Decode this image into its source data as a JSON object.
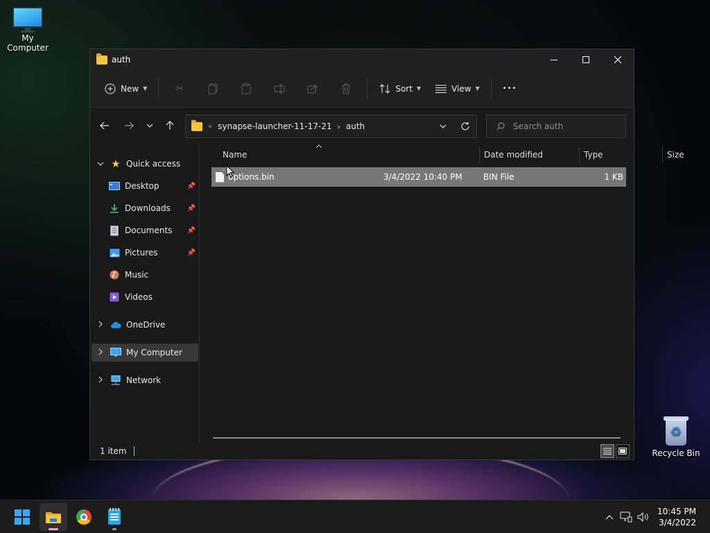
{
  "desktop": {
    "icons": [
      {
        "label": "My Computer",
        "icon": "monitor-icon"
      },
      {
        "label": "Recycle Bin",
        "icon": "recycle-bin-icon"
      }
    ]
  },
  "window": {
    "title": "auth",
    "title_icon": "folder-icon",
    "controls": {
      "minimize": "minimize-icon",
      "maximize": "maximize-icon",
      "close": "close-icon"
    }
  },
  "commandbar": {
    "new_label": "New",
    "sort_label": "Sort",
    "view_label": "View",
    "more_label": "•••",
    "icons": [
      "cut-icon",
      "copy-icon",
      "paste-icon",
      "rename-icon",
      "share-icon",
      "delete-icon"
    ]
  },
  "address": {
    "overflow": "«",
    "crumbs": [
      "synapse-launcher-11-17-21",
      "auth"
    ]
  },
  "search": {
    "placeholder": "Search auth"
  },
  "navpane": {
    "quick_access": "Quick access",
    "items": [
      {
        "label": "Desktop",
        "icon": "desktop-icon",
        "pinned": true
      },
      {
        "label": "Downloads",
        "icon": "downloads-icon",
        "pinned": true
      },
      {
        "label": "Documents",
        "icon": "documents-icon",
        "pinned": true
      },
      {
        "label": "Pictures",
        "icon": "pictures-icon",
        "pinned": true
      },
      {
        "label": "Music",
        "icon": "music-icon",
        "pinned": false
      },
      {
        "label": "Videos",
        "icon": "videos-icon",
        "pinned": false
      }
    ],
    "onedrive": "OneDrive",
    "my_computer": "My Computer",
    "network": "Network"
  },
  "filelist": {
    "columns": [
      "Name",
      "Date modified",
      "Type",
      "Size"
    ],
    "rows": [
      {
        "name": "options.bin",
        "date": "3/4/2022 10:40 PM",
        "type": "BIN File",
        "size": "1 KB"
      }
    ]
  },
  "statusbar": {
    "count": "1 item"
  },
  "taskbar": {
    "apps": [
      "start-icon",
      "file-explorer-icon",
      "chrome-icon",
      "notepad-icon"
    ],
    "time": "10:45 PM",
    "date": "3/4/2022"
  },
  "colors": {
    "window_bg": "#191919",
    "chrome_bg": "#202020",
    "selection": "#777777",
    "folder": "#f3c63f",
    "accent": "#3aa8f0"
  }
}
